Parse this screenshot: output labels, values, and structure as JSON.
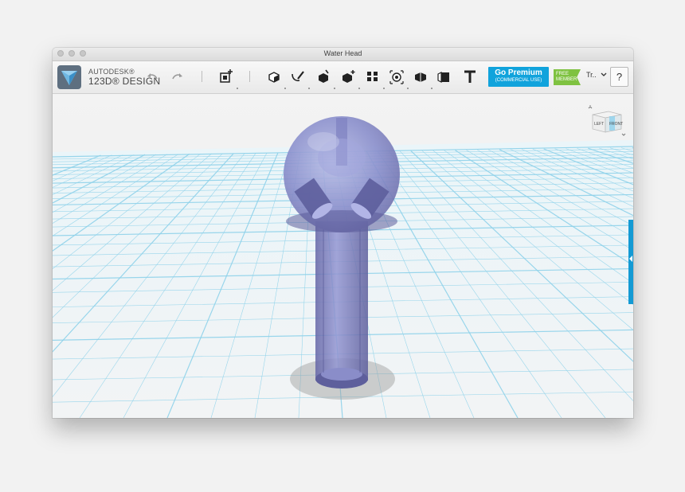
{
  "window": {
    "title": "Water Head"
  },
  "toolbar": {
    "brand_line1": "AUTODESK®",
    "brand_line2": "123D® DESIGN",
    "undo_icon": "undo-arrow-icon",
    "redo_icon": "redo-arrow-icon",
    "tools": [
      "add-primitive-icon",
      "transform-icon",
      "sketch-icon",
      "construct-icon",
      "modify-icon",
      "pattern-icon",
      "group-icon",
      "combine-icon",
      "measure-icon",
      "text-icon"
    ],
    "premium_title": "Go Premium",
    "premium_sub": "(COMMERCIAL USE)",
    "free_line1": "FREE",
    "free_line2": "MEMBER",
    "user_label": "Tr..",
    "help_label": "?"
  },
  "viewcube": {
    "left_label": "LEFT",
    "front_label": "FRONT"
  },
  "colors": {
    "accent": "#11a3dc",
    "free_badge": "#7fc241",
    "grid_line": "#8fd2ea",
    "model": "#6f6fb0"
  }
}
